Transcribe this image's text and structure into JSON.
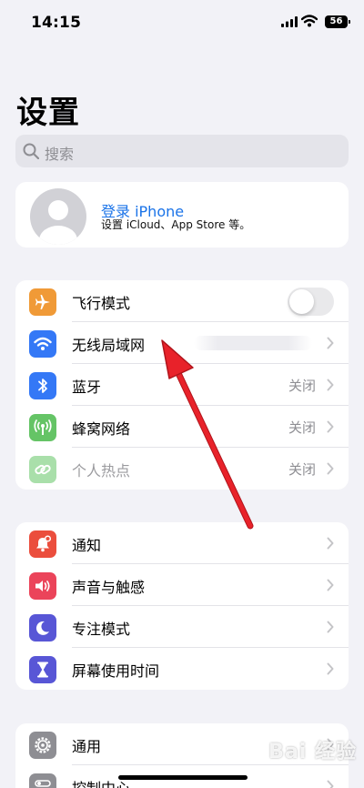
{
  "status_bar": {
    "time": "14:15",
    "battery": "56",
    "signal_icon": "cellular-signal-icon",
    "wifi_icon": "wifi-icon",
    "battery_icon": "battery-icon"
  },
  "header": {
    "title": "设置"
  },
  "search": {
    "placeholder": "搜索",
    "icon": "search-icon"
  },
  "account": {
    "title": "登录 iPhone",
    "subtitle": "设置 iCloud、App Store 等。",
    "icon": "avatar-icon"
  },
  "group_1": {
    "items": [
      {
        "label": "飞行模式",
        "icon": "airplane-icon",
        "color": "#f09a37",
        "control": "toggle",
        "toggle_on": false
      },
      {
        "label": "无线局域网",
        "icon": "wifi-icon",
        "color": "#3478f6",
        "value": ""
      },
      {
        "label": "蓝牙",
        "icon": "bluetooth-icon",
        "color": "#3478f6",
        "value": "关闭"
      },
      {
        "label": "蜂窝网络",
        "icon": "cellular-antenna-icon",
        "color": "#65c466",
        "value": "关闭"
      },
      {
        "label": "个人热点",
        "icon": "hotspot-link-icon",
        "color": "#65c466",
        "value": "关闭",
        "dimmed": true
      }
    ]
  },
  "group_2": {
    "items": [
      {
        "label": "通知",
        "icon": "notification-bell-icon",
        "color": "#eb4e3d"
      },
      {
        "label": "声音与触感",
        "icon": "speaker-icon",
        "color": "#eb445a"
      },
      {
        "label": "专注模式",
        "icon": "moon-icon",
        "color": "#5856d6"
      },
      {
        "label": "屏幕使用时间",
        "icon": "hourglass-icon",
        "color": "#5856d6"
      }
    ]
  },
  "group_3": {
    "items": [
      {
        "label": "通用",
        "icon": "gear-icon",
        "color": "#8e8e93"
      },
      {
        "label": "控制中心",
        "icon": "toggles-icon",
        "color": "#8e8e93"
      }
    ]
  },
  "watermark": {
    "text": "Bai 经验"
  },
  "annotation": {
    "type": "red-arrow",
    "color": "#e8222a",
    "target": "无线局域网"
  }
}
